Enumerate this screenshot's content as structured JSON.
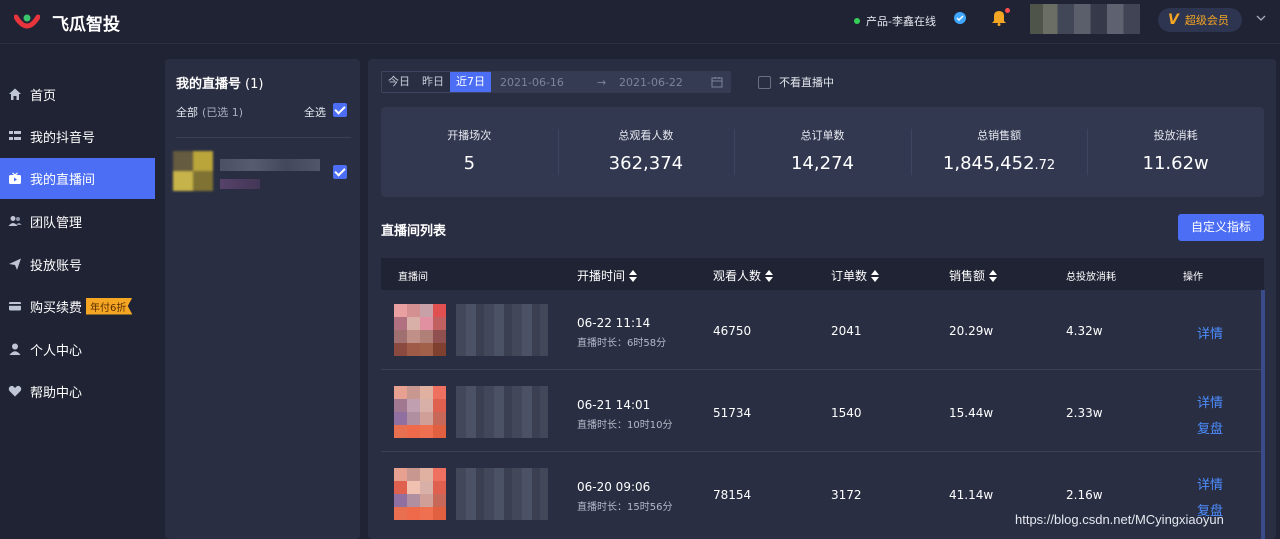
{
  "app": {
    "brand": "飞瓜智投"
  },
  "header": {
    "online_status": "产品-李鑫在线",
    "vip_label": "超级会员",
    "vip_mark": "V",
    "colors": {
      "accent": "#4c6ef5",
      "online": "#34d058",
      "vip": "#f5a623",
      "notify": "#ff4d4f"
    }
  },
  "sidebar": {
    "items": [
      {
        "label": "首页",
        "icon": "home-icon"
      },
      {
        "label": "我的抖音号",
        "icon": "list-icon"
      },
      {
        "label": "我的直播间",
        "icon": "live-icon",
        "active": true
      },
      {
        "label": "团队管理",
        "icon": "team-icon"
      },
      {
        "label": "投放账号",
        "icon": "send-icon"
      },
      {
        "label": "购买续费",
        "icon": "card-icon",
        "badge": "年付6折"
      },
      {
        "label": "个人中心",
        "icon": "user-icon"
      },
      {
        "label": "帮助中心",
        "icon": "help-icon"
      }
    ]
  },
  "accounts": {
    "title": "我的直播号",
    "count": "(1)",
    "all_label": "全部",
    "selected_note": "(已选 1)",
    "select_all": "全选"
  },
  "filters": {
    "quick_ranges": [
      "今日",
      "昨日",
      "近7日"
    ],
    "active_range": "近7日",
    "start_date": "2021-06-16",
    "arrow": "→",
    "end_date": "2021-06-22",
    "hide_not_live": "不看直播中"
  },
  "stats": [
    {
      "label": "开播场次",
      "value": "5"
    },
    {
      "label": "总观看人数",
      "value": "362,374"
    },
    {
      "label": "总订单数",
      "value": "14,274"
    },
    {
      "label": "总销售额",
      "value": "1,845,452",
      "decimal": ".72"
    },
    {
      "label": "投放消耗",
      "value": "11.62w"
    }
  ],
  "list": {
    "title": "直播间列表",
    "custom_button": "自定义指标",
    "columns": [
      "直播间",
      "开播时间",
      "观看人数",
      "订单数",
      "销售额",
      "总投放消耗",
      "操作"
    ],
    "rows": [
      {
        "start": "06-22 11:14",
        "duration": "直播时长：6时58分",
        "viewers": "46750",
        "orders": "2041",
        "sales": "20.29w",
        "ad_spend": "4.32w",
        "actions": [
          "详情"
        ]
      },
      {
        "start": "06-21 14:01",
        "duration": "直播时长：10时10分",
        "viewers": "51734",
        "orders": "1540",
        "sales": "15.44w",
        "ad_spend": "2.33w",
        "actions": [
          "详情",
          "复盘"
        ]
      },
      {
        "start": "06-20 09:06",
        "duration": "直播时长：15时56分",
        "viewers": "78154",
        "orders": "3172",
        "sales": "41.14w",
        "ad_spend": "2.16w",
        "actions": [
          "详情",
          "复盘"
        ]
      }
    ]
  },
  "watermark": "https://blog.csdn.net/MCyingxiaoyun"
}
